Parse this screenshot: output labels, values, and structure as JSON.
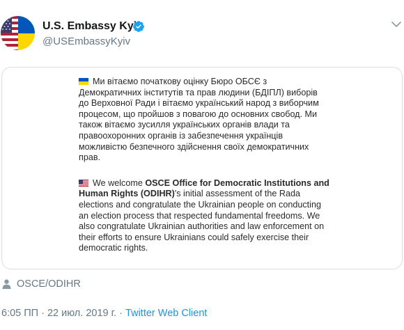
{
  "author": {
    "name": "U.S. Embassy Kyiv",
    "handle": "@USEmbassyKyiv",
    "verified_icon": "verified-badge-icon",
    "avatar_icon": "us-ukraine-split-flag"
  },
  "media": {
    "ua_text": "Ми вітаємо початкову оцінку Бюро ОБСЄ з Демократичних інститутів та прав людини (БДІПЛ) виборів до Верховної Ради і вітаємо український народ з виборчим процесом, що пройшов з повагою до основних свобод. Ми також вітаємо зусилля українських органів влади та правоохоронних органів із забезпечення українців можливістю безпечного здійснення своїх демократичних прав.",
    "en_prefix": "We welcome ",
    "en_bold": "OSCE Office for Democratic Institutions and Human Rights (ODIHR)",
    "en_rest": "'s initial assessment of the Rada elections and congratulate the Ukrainian people on conducting an election process that respected fundamental freedoms. We also congratulate Ukrainian authorities and law enforcement on their efforts to ensure Ukrainians could safely exercise their democratic rights."
  },
  "tagged": {
    "label": "OSCE/ODIHR",
    "icon": "person-icon"
  },
  "meta": {
    "time": "6:05 ПП",
    "separator": " · ",
    "date": "22 июл. 2019 г.",
    "client": "Twitter Web Client"
  },
  "colors": {
    "text_primary": "#14171a",
    "text_secondary": "#657786",
    "link": "#1b95e0",
    "verified": "#1da1f2",
    "ua_blue": "#0057b7",
    "ua_yellow": "#ffd700"
  }
}
